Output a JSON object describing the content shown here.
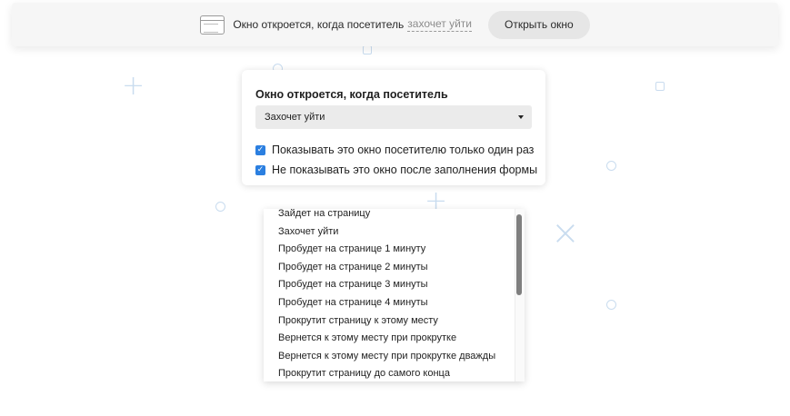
{
  "topbar": {
    "icon": "browser-window-icon",
    "text": "Окно откроется, когда посетитель",
    "trigger_link": "захочет уйти",
    "open_button": "Открыть окно"
  },
  "panel": {
    "title": "Окно откроется, когда посетитель",
    "select_value": "Захочет уйти",
    "checkbox_one_label": "Показывать это окно посетителю только один раз",
    "checkbox_one_checked": true,
    "checkbox_two_label": "Не показывать это окно после заполнения формы",
    "checkbox_two_checked": true
  },
  "dropdown": {
    "options": [
      "Зайдет на страницу",
      "Захочет уйти",
      "Пробудет на странице 1 минуту",
      "Пробудет на странице 2 минуты",
      "Пробудет на странице 3 минуты",
      "Пробудет на странице 4 минуты",
      "Прокрутит страницу к этому месту",
      "Вернется к этому месту при прокрутке",
      "Вернется к этому месту при прокрутке дважды",
      "Прокрутит страницу до самого конца"
    ]
  },
  "colors": {
    "checkbox_accent": "#2b7fe0",
    "decoration": "#c9dcef",
    "button_bg": "#e6e6e6"
  }
}
